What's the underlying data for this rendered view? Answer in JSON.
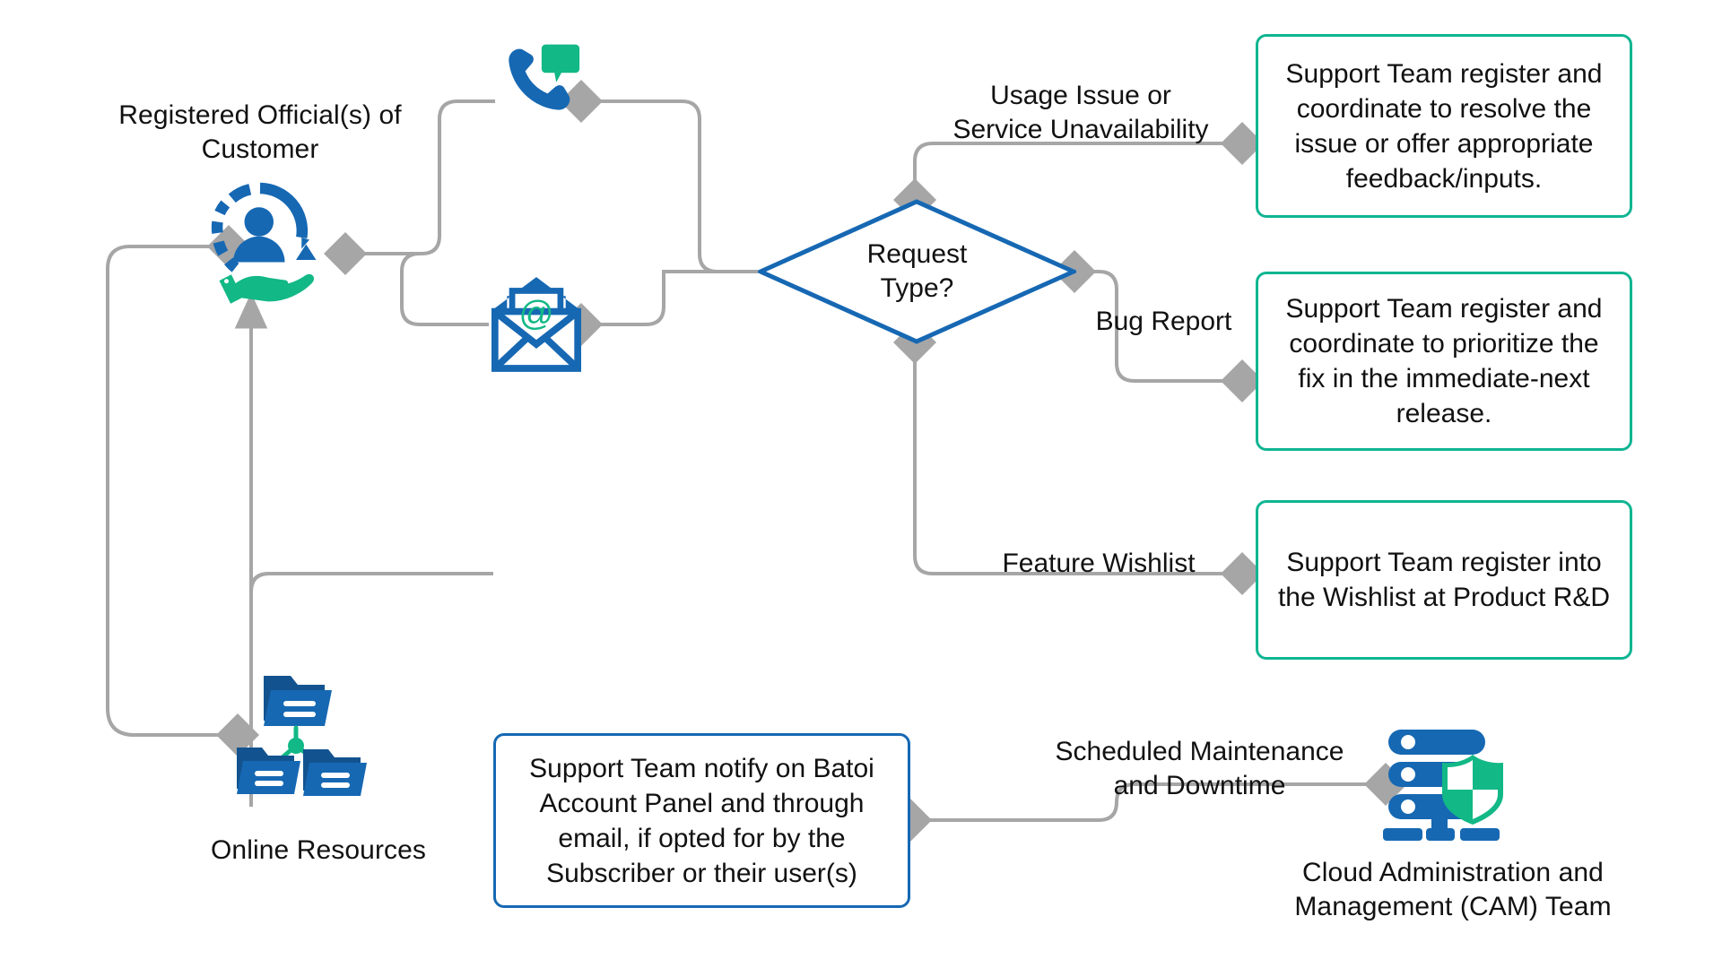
{
  "diagram": {
    "title": "Customer Support Request Flow",
    "colors": {
      "blue": "#1668b3",
      "blue_dark": "#12538f",
      "teal": "#0fb592",
      "teal_dark": "#07a183",
      "connector": "#a6a6a6",
      "text": "#111111",
      "background": "#ffffff"
    }
  },
  "actors": [
    {
      "id": "registered-official",
      "label": "Registered Official(s) of\nCustomer",
      "icon": "person-in-circle-with-hand-icon"
    },
    {
      "id": "online-resources",
      "label": "Online Resources",
      "icon": "folders-network-icon"
    },
    {
      "id": "cam-team",
      "label": "Cloud Administration and\nManagement (CAM) Team",
      "icon": "server-shield-icon"
    }
  ],
  "channels": [
    {
      "id": "phone",
      "icon": "phone-chat-icon",
      "label": ""
    },
    {
      "id": "email",
      "icon": "email-envelope-at-icon",
      "label": ""
    }
  ],
  "decision": {
    "id": "request-type",
    "label": "Request\nType?"
  },
  "edge_labels": [
    {
      "id": "usage-issue",
      "text": "Usage Issue or\nService Unavailability"
    },
    {
      "id": "bug-report",
      "text": "Bug Report"
    },
    {
      "id": "feature-wishlist",
      "text": "Feature Wishlist"
    },
    {
      "id": "scheduled-maintenance",
      "text": "Scheduled Maintenance\nand Downtime"
    }
  ],
  "process_boxes": [
    {
      "id": "resolve-issue",
      "text": "Support Team register and coordinate to resolve the issue or offer appropriate feedback/inputs.",
      "border": "#0fb592"
    },
    {
      "id": "prioritize-fix",
      "text": "Support Team register and coordinate to prioritize the fix in the immediate-next release.",
      "border": "#0fb592"
    },
    {
      "id": "register-wishlist",
      "text": "Support Team register into the Wishlist at Product R&D",
      "border": "#0fb592"
    },
    {
      "id": "notify-subscriber",
      "text": "Support Team notify on Batoi Account Panel and through email, if opted for by the Subscriber or their user(s)",
      "border": "#1668b3"
    }
  ]
}
